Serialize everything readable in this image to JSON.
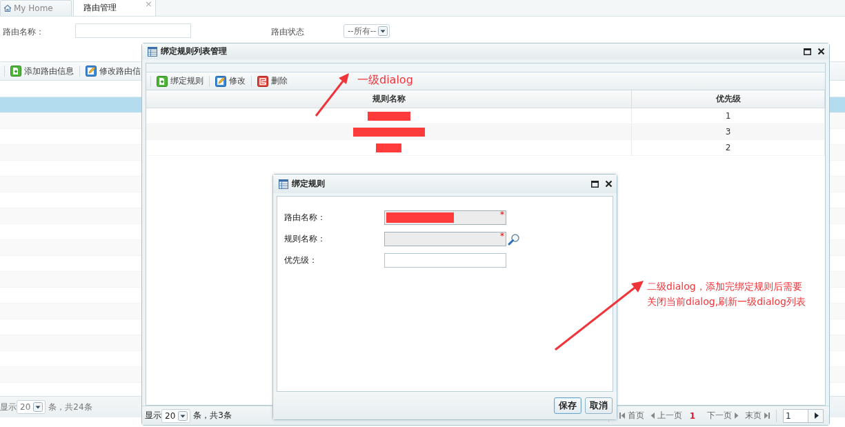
{
  "tabs": [
    {
      "label": "My Home",
      "selected": false
    },
    {
      "label": "路由管理",
      "selected": true,
      "close": "×"
    }
  ],
  "search": {
    "fields": [
      {
        "kind": "text",
        "label": "路由名称："
      },
      {
        "kind": "select",
        "label": "路由状态",
        "value": "--所有--"
      }
    ]
  },
  "toolbar": [
    {
      "kind": "add",
      "label": "添加路由信息"
    },
    {
      "kind": "edit",
      "label": "修改路由信"
    }
  ],
  "grid": {
    "rows": [
      {
        "selected": true
      },
      {
        "selected": false
      },
      {
        "selected": false
      },
      {
        "selected": false
      },
      {
        "selected": false
      },
      {
        "selected": false
      },
      {
        "selected": false
      },
      {
        "selected": false
      },
      {
        "selected": false
      },
      {
        "selected": false
      },
      {
        "selected": false
      },
      {
        "selected": false
      },
      {
        "selected": false
      },
      {
        "selected": false
      },
      {
        "selected": false
      },
      {
        "selected": false
      },
      {
        "selected": false
      },
      {
        "selected": false
      }
    ]
  },
  "footer": {
    "prefix": "显示",
    "page_size": "20",
    "suffix": "条，共24条"
  },
  "dialogs": [
    {
      "title": "绑定规则列表管理",
      "toolbar": [
        {
          "kind": "add",
          "label": "绑定规则"
        },
        {
          "kind": "edit",
          "label": "修改"
        },
        {
          "kind": "delete",
          "label": "删除"
        }
      ],
      "table": {
        "columns": [
          "规则名称",
          "优先级"
        ],
        "rows": [
          {
            "redacted": true,
            "priority": "1"
          },
          {
            "redacted": true,
            "priority": "3"
          },
          {
            "redacted": true,
            "priority": "2"
          }
        ]
      },
      "footer": {
        "prefix": "显示",
        "page_size": "20",
        "suffix": "条，共3条"
      },
      "pager": {
        "first": "首页",
        "prev": "上一页",
        "current": "1",
        "next": "下一页",
        "last": "末页",
        "page_input": "1"
      }
    },
    {
      "title": "绑定规则",
      "fields": [
        {
          "label": "路由名称：",
          "readonly": true,
          "redacted": true,
          "required_mark": "*",
          "lookup": false
        },
        {
          "label": "规则名称：",
          "readonly": true,
          "required_mark": "*",
          "lookup": true
        },
        {
          "label": "优先级：",
          "readonly": false,
          "lookup": false
        }
      ],
      "buttons": [
        {
          "label": "保存",
          "default": true
        },
        {
          "label": "取消",
          "default": false
        }
      ]
    }
  ],
  "annotations": [
    {
      "lines": [
        "一级dialog"
      ]
    },
    {
      "lines": [
        "二级dialog，添加完绑定规则后需要",
        "关闭当前dialog,刷新一级dialog列表"
      ]
    }
  ]
}
